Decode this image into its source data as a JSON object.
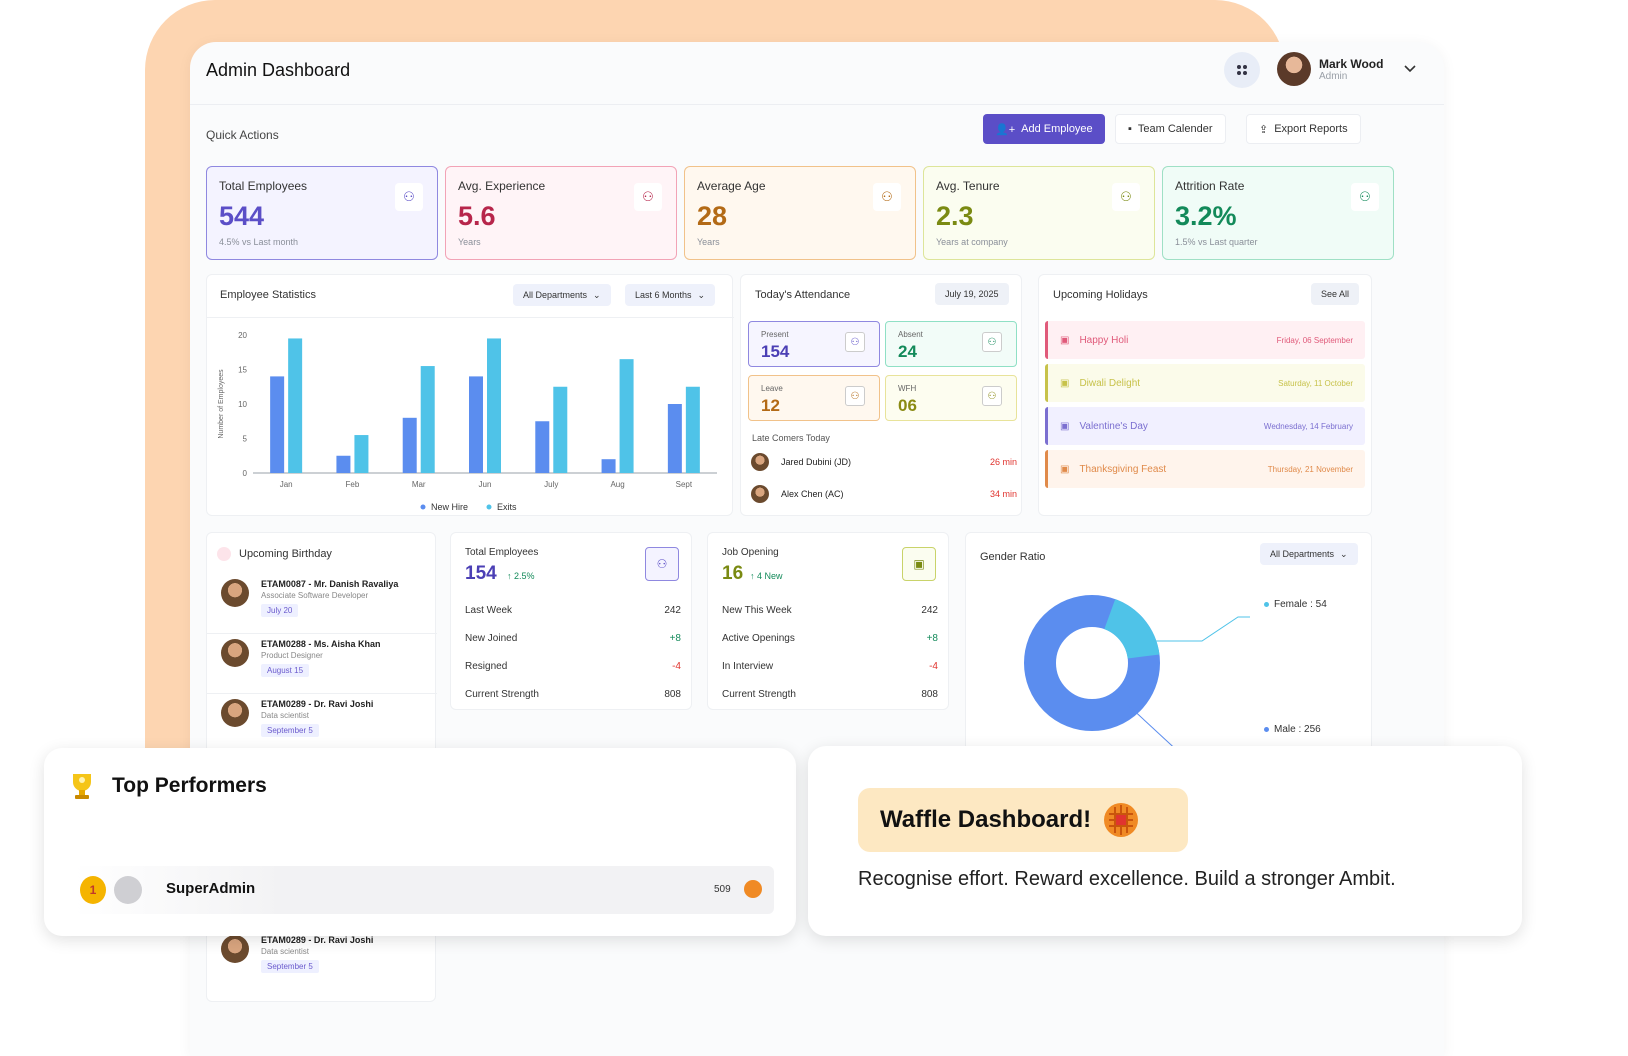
{
  "header": {
    "title": "Admin Dashboard",
    "user_name": "Mark Wood",
    "user_role": "Admin"
  },
  "quick_actions": {
    "label": "Quick Actions",
    "add_employee": "Add Employee",
    "team_calendar": "Team Calender",
    "export_reports": "Export Reports"
  },
  "stats": [
    {
      "label": "Total Employees",
      "value": "544",
      "sub": "4.5% vs Last month",
      "color": "#5b4ec7",
      "border": "#8f88e0",
      "bg": "#f4f3ff"
    },
    {
      "label": "Avg. Experience",
      "value": "5.6",
      "sub": "Years",
      "color": "#b7264b",
      "border": "#f2a3b6",
      "bg": "#fff4f7"
    },
    {
      "label": "Average Age",
      "value": "28",
      "sub": "Years",
      "color": "#b36a16",
      "border": "#f1c28a",
      "bg": "#fff8ef"
    },
    {
      "label": "Avg. Tenure",
      "value": "2.3",
      "sub": "Years at company",
      "color": "#7a8a12",
      "border": "#dde59a",
      "bg": "#fbfdf0"
    },
    {
      "label": "Attrition Rate",
      "value": "3.2%",
      "sub": "1.5% vs Last quarter",
      "color": "#138a5a",
      "border": "#9fe0c5",
      "bg": "#f0fcf7"
    }
  ],
  "employee_statistics": {
    "title": "Employee Statistics",
    "filter_dept": "All Departments",
    "filter_period": "Last 6 Months",
    "legend_new": "New Hire",
    "legend_exit": "Exits"
  },
  "chart_data": {
    "type": "bar",
    "ylabel": "Number of Employees",
    "ylim": [
      0,
      20
    ],
    "yticks": [
      "0",
      "5",
      "10",
      "15",
      "20"
    ],
    "categories": [
      "Jan",
      "Feb",
      "Mar",
      "Jun",
      "July",
      "Aug",
      "Sept"
    ],
    "series": [
      {
        "name": "New Hire",
        "color": "#5b8def",
        "values": [
          14,
          2.5,
          8,
          14,
          7.5,
          2,
          10
        ]
      },
      {
        "name": "Exits",
        "color": "#4fc3e8",
        "values": [
          19.5,
          5.5,
          15.5,
          19.5,
          12.5,
          16.5,
          12.5
        ]
      }
    ]
  },
  "attendance": {
    "title": "Today's Attendance",
    "date": "July 19, 2025",
    "present_label": "Present",
    "present_value": "154",
    "absent_label": "Absent",
    "absent_value": "24",
    "leave_label": "Leave",
    "leave_value": "12",
    "wfh_label": "WFH",
    "wfh_value": "06",
    "late_title": "Late Comers Today",
    "late": [
      {
        "name": "Jared Dubini (JD)",
        "time": "26 min"
      },
      {
        "name": "Alex Chen (AC)",
        "time": "34 min"
      }
    ]
  },
  "holidays": {
    "title": "Upcoming Holidays",
    "see_all": "See All",
    "items": [
      {
        "name": "Happy Holi",
        "date": "Friday, 06 September",
        "color": "#e05a7a",
        "bg": "#fff0f3"
      },
      {
        "name": "Diwali Delight",
        "date": "Saturday, 11 October",
        "color": "#c7c24a",
        "bg": "#fbfbea"
      },
      {
        "name": "Valentine's Day",
        "date": "Wednesday, 14 February",
        "color": "#7b6fd0",
        "bg": "#f1f0ff"
      },
      {
        "name": "Thanksgiving Feast",
        "date": "Thursday, 21 November",
        "color": "#e08a4a",
        "bg": "#fff4ec"
      }
    ]
  },
  "birthday": {
    "title": "Upcoming Birthday",
    "items": [
      {
        "name": "ETAM0087 - Mr. Danish Ravaliya",
        "role": "Associate Software Developer",
        "date": "July 20"
      },
      {
        "name": "ETAM0288 - Ms. Aisha Khan",
        "role": "Product Designer",
        "date": "August 15"
      },
      {
        "name": "ETAM0289 - Dr. Ravi Joshi",
        "role": "Data scientist",
        "date": "September 5"
      }
    ]
  },
  "total_employees_card": {
    "title": "Total Employees",
    "value": "154",
    "trend": "↑ 2.5%",
    "rows": [
      {
        "label": "Last Week",
        "value": "242"
      },
      {
        "label": "New Joined",
        "value": "+8"
      },
      {
        "label": "Resigned",
        "value": "-4"
      },
      {
        "label": "Current Strength",
        "value": "808"
      }
    ]
  },
  "job_opening_card": {
    "title": "Job Opening",
    "value": "16",
    "trend": "↑ 4 New",
    "rows": [
      {
        "label": "New This Week",
        "value": "242"
      },
      {
        "label": "Active Openings",
        "value": "+8"
      },
      {
        "label": "In Interview",
        "value": "-4"
      },
      {
        "label": "Current Strength",
        "value": "808"
      }
    ]
  },
  "gender_ratio": {
    "title": "Gender Ratio",
    "filter": "All Departments",
    "female_label": "Female : 54",
    "male_label": "Male : 256",
    "female": 54,
    "male": 256
  },
  "top_performers": {
    "title": "Top Performers",
    "name": "SuperAdmin",
    "rank": "1",
    "score": "509"
  },
  "waffle": {
    "title": "Waffle Dashboard!",
    "tagline": "Recognise effort. Reward excellence. Build a stronger Ambit."
  }
}
